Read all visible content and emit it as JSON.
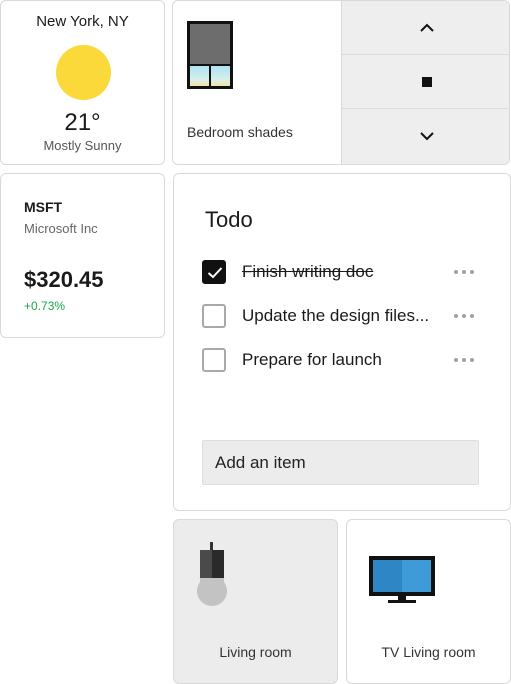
{
  "weather": {
    "city": "New York, NY",
    "temperature": "21°",
    "condition": "Mostly Sunny",
    "icon": "sun-icon"
  },
  "shades": {
    "label": "Bedroom shades",
    "icon": "window-shade-icon",
    "controls": [
      {
        "name": "shade-up-button",
        "icon": "chevron-up-icon"
      },
      {
        "name": "shade-stop-button",
        "icon": "stop-icon"
      },
      {
        "name": "shade-down-button",
        "icon": "chevron-down-icon"
      }
    ]
  },
  "stock": {
    "ticker": "MSFT",
    "company": "Microsoft Inc",
    "price": "$320.45",
    "change": "+0.73%",
    "change_color": "#19a84a"
  },
  "todo": {
    "title": "Todo",
    "items": [
      {
        "text": "Finish writing doc",
        "checked": true
      },
      {
        "text": "Update the design files...",
        "checked": false
      },
      {
        "text": "Prepare for launch",
        "checked": false
      }
    ],
    "add_item_placeholder": "Add an item"
  },
  "tiles": {
    "living_room": {
      "label": "Living room",
      "icon": "light-bulb-icon"
    },
    "tv_living_room": {
      "label": "TV Living room",
      "icon": "tv-icon"
    }
  },
  "colors": {
    "sun": "#fbd93a",
    "tv_screen": "#2f86c4",
    "selected_tile": "#ececec"
  }
}
